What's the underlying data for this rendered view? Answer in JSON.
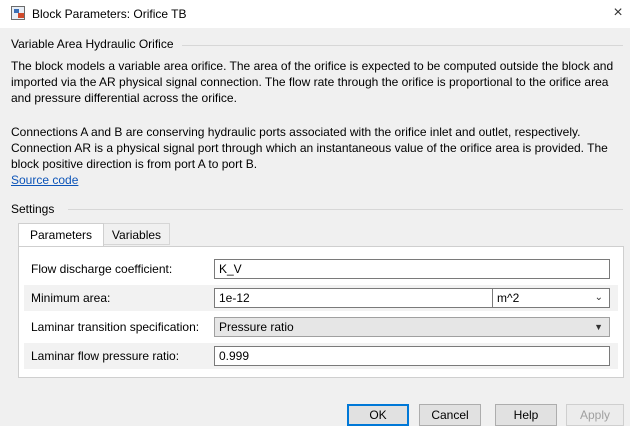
{
  "window": {
    "title": "Block Parameters: Orifice TB",
    "close_glyph": "×"
  },
  "description": {
    "heading": "Variable Area Hydraulic Orifice",
    "para1": "The block models a variable area orifice. The area of the orifice is expected to be computed outside the block and imported via the AR physical signal connection. The flow rate through the orifice is proportional to the orifice area and pressure differential across the orifice.",
    "para2": "Connections A and B are conserving hydraulic ports associated with the orifice inlet and outlet, respectively. Connection AR is a physical signal port through which an instantaneous value of the orifice area is provided. The block positive direction is from port A to port B.",
    "source_link": "Source code"
  },
  "settings": {
    "heading": "Settings",
    "tabs": [
      {
        "label": "Parameters",
        "active": true
      },
      {
        "label": "Variables",
        "active": false
      }
    ],
    "params": [
      {
        "label": "Flow discharge coefficient:",
        "value": "K_V"
      },
      {
        "label": "Minimum area:",
        "value": "1e-12",
        "unit": "m^2"
      },
      {
        "label": "Laminar transition specification:",
        "value": "Pressure ratio"
      },
      {
        "label": "Laminar flow pressure ratio:",
        "value": "0.999"
      }
    ]
  },
  "buttons": {
    "ok": "OK",
    "cancel": "Cancel",
    "help": "Help",
    "apply": "Apply"
  },
  "icons": {
    "window_icon": "simulink-block-icon",
    "unit_dropdown": "chevron-down-icon",
    "spec_dropdown": "caret-down-icon"
  },
  "colors": {
    "link": "#0c54b8",
    "default_button_border": "#0078d7",
    "background": "#f0f0f0"
  }
}
